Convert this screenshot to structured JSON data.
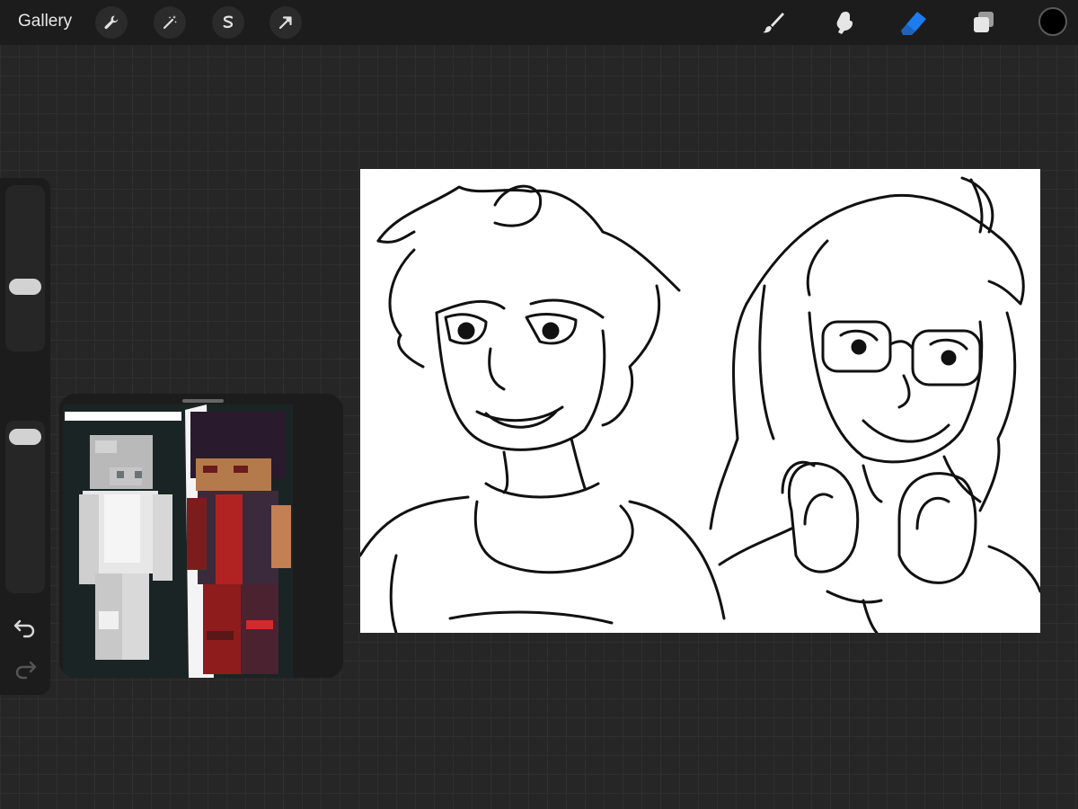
{
  "topbar": {
    "gallery_label": "Gallery",
    "left_tools": [
      {
        "name": "actions-wrench-icon"
      },
      {
        "name": "adjustments-magic-wand-icon"
      },
      {
        "name": "selection-s-icon"
      },
      {
        "name": "transform-arrow-icon"
      }
    ],
    "right_tools": [
      {
        "name": "brush-icon",
        "active": false
      },
      {
        "name": "smudge-icon",
        "active": false
      },
      {
        "name": "eraser-icon",
        "active": true
      },
      {
        "name": "layers-icon",
        "active": false
      }
    ],
    "current_color": "#000000",
    "accent_color": "#1d7cf2"
  },
  "sidebar": {
    "brush_size_level": 0.38,
    "opacity_level": 0.95,
    "icons": [
      "modify-square-icon",
      "undo-icon",
      "redo-icon"
    ]
  },
  "reference_window": {
    "content": "reference-image-two-minecraft-skins"
  },
  "canvas": {
    "background": "#ffffff",
    "content": "line-art-sketch-two-characters"
  }
}
